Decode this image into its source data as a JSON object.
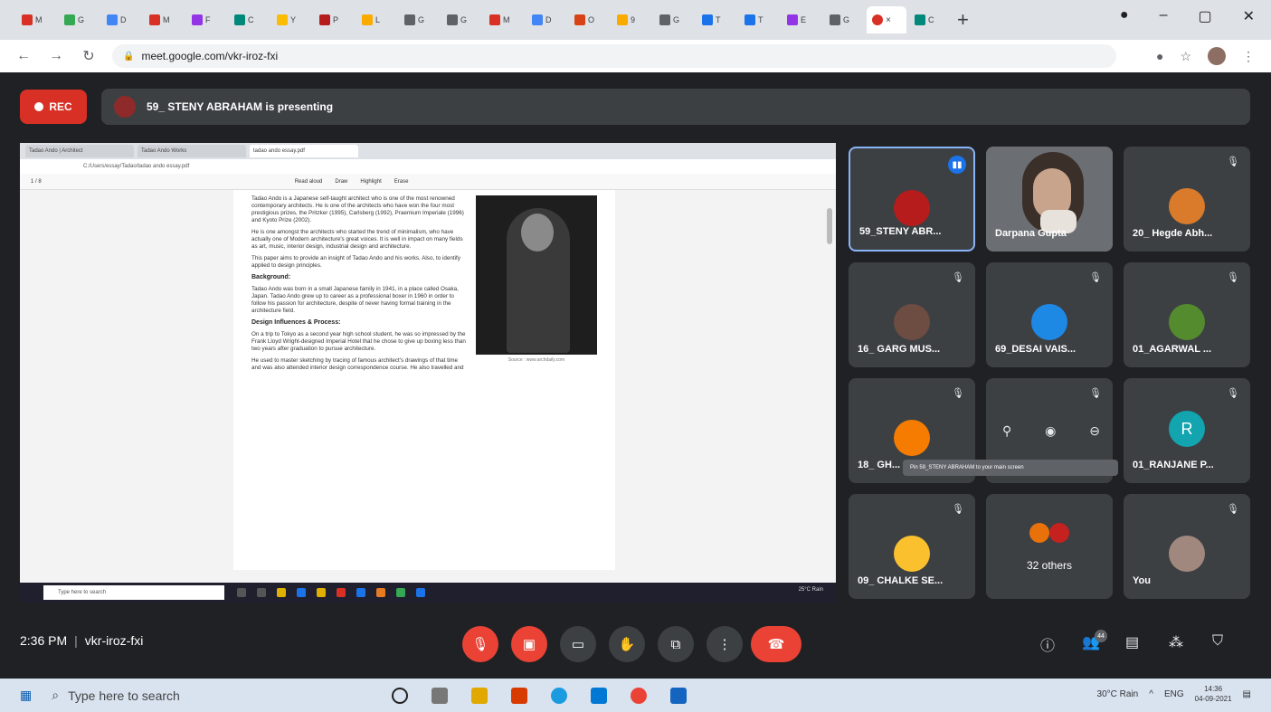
{
  "browser": {
    "tabs": [
      {
        "label": "M",
        "color": "#d93025"
      },
      {
        "label": "G",
        "color": "#34a853"
      },
      {
        "label": "D",
        "color": "#4285f4"
      },
      {
        "label": "M",
        "color": "#d93025"
      },
      {
        "label": "F",
        "color": "#9334e6"
      },
      {
        "label": "C",
        "color": "#00897b"
      },
      {
        "label": "Y",
        "color": "#fbbc04"
      },
      {
        "label": "P",
        "color": "#b71c1c"
      },
      {
        "label": "L",
        "color": "#f9ab00"
      },
      {
        "label": "G",
        "color": "#5f6368"
      },
      {
        "label": "G",
        "color": "#5f6368"
      },
      {
        "label": "M",
        "color": "#d93025"
      },
      {
        "label": "D",
        "color": "#4285f4"
      },
      {
        "label": "O",
        "color": "#d84315"
      },
      {
        "label": "9",
        "color": "#f9ab00"
      },
      {
        "label": "G",
        "color": "#5f6368"
      },
      {
        "label": "T",
        "color": "#1a73e8"
      },
      {
        "label": "T",
        "color": "#1a73e8"
      },
      {
        "label": "E",
        "color": "#9334e6"
      },
      {
        "label": "G",
        "color": "#5f6368"
      },
      {
        "label": "C",
        "color": "#00897b"
      }
    ],
    "active_tab_close": "×",
    "new_tab": "+",
    "url": "meet.google.com/vkr-iroz-fxi"
  },
  "meet": {
    "rec_label": "REC",
    "presenter_text": "59_ STENY ABRAHAM is presenting",
    "time": "2:36 PM",
    "meeting_code": "vkr-iroz-fxi",
    "participants_badge": "44",
    "tooltip": "Pin 59_STENY ABRAHAM to your main screen",
    "tiles": [
      {
        "name": "59_STENY ABR...",
        "speaking": true,
        "avatar": "#b71c1c"
      },
      {
        "name": "Darpana Gupta",
        "video": true
      },
      {
        "name": "20_ Hegde Abh...",
        "avatar": "#d97b2b"
      },
      {
        "name": "16_ GARG MUS...",
        "avatar": "#6d4c41"
      },
      {
        "name": "69_DESAI VAIS...",
        "avatar": "#1e88e5"
      },
      {
        "name": "01_AGARWAL ...",
        "avatar": "#558b2f"
      },
      {
        "name": "18_ GH...",
        "avatar": "#f57c00"
      },
      {
        "name": ""
      },
      {
        "name": "01_RANJANE P...",
        "letter": "R"
      },
      {
        "name": "09_ CHALKE SE...",
        "avatar": "#fbc02d"
      },
      {
        "name": "32 others"
      },
      {
        "name": "You",
        "avatar": "#a1887f"
      }
    ]
  },
  "shared": {
    "tab1": "Tadao Ando | Architect",
    "tab2": "Tadao Ando Works",
    "tab3": "tadao ando essay.pdf",
    "address": "C:/Users/essay/Tadao/tadao ando essay.pdf",
    "page_info": "1 / 8",
    "toolbar_items": [
      "Read aloud",
      "Draw",
      "Highlight",
      "Erase"
    ],
    "para1": "Tadao Ando is a Japanese self-taught architect who is one of the most renowned contemporary architects. He is one of the architects who have won the four most prestigious prizes, the Pritzker (1995), Carlsberg (1992), Praemium Imperiale (1996) and Kyoto Prize (2002).",
    "para2": "He is one amongst the architects who started the trend of minimalism, who have actually one of Modern architecture's great voices. It is well in impact on many fields as art, music, interior design, industrial design and architecture.",
    "para3": "This paper aims to provide an insight of Tadao Ando and his works. Also, to identify applied to design principles.",
    "caption": "Source : www.archdaily.com",
    "h1": "Background:",
    "para4": "Tadao Ando was born in a small Japanese family in 1941, in a place called Osaka, Japan. Tadao Ando grew up to career as a professional boxer in 1960 in order to follow his passion for architecture, despite of never having formal training in the architecture field.",
    "h2": "Design Influences & Process:",
    "para5": "On a trip to Tokyo as a second year high school student, he was so impressed by the Frank Lloyd Wright-designed Imperial Hotel that he chose to give up boxing less than two years after graduation to pursue architecture.",
    "para6": "He used to master sketching by tracing of famous architect's drawings of that time and was also attended interior design correspondence course. He also travelled and",
    "taskbar_search": "Type here to search",
    "tray": "25°C Rain"
  },
  "taskbar": {
    "search": "Type here to search",
    "weather": "30°C Rain",
    "lang": "ENG",
    "time": "14:36",
    "date": "04-09-2021"
  }
}
